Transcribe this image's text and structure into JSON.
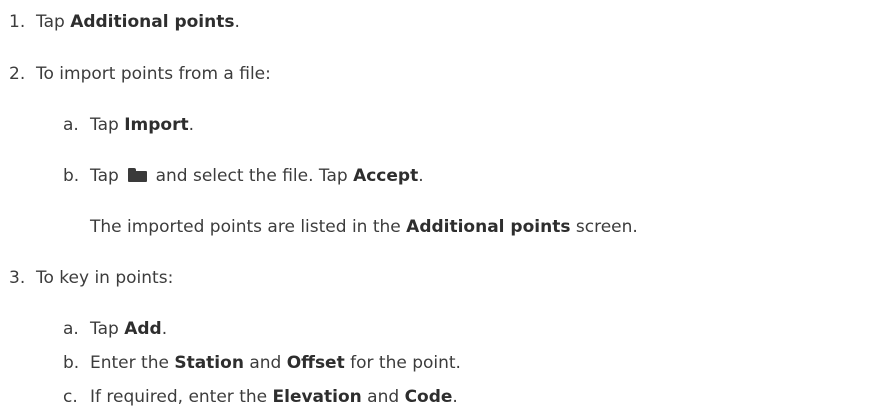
{
  "steps": [
    {
      "number": "1.",
      "parts": [
        "Tap ",
        "Additional points",
        "."
      ]
    },
    {
      "number": "2.",
      "text": "To import points from a file:",
      "substeps": [
        {
          "letter": "a.",
          "parts": [
            "Tap ",
            "Import",
            "."
          ]
        },
        {
          "letter": "b.",
          "parts": [
            "Tap ",
            " and select the file. Tap ",
            "Accept",
            "."
          ],
          "icon": "folder-icon",
          "note_parts": [
            "The imported points are listed in the ",
            "Additional points",
            " screen."
          ]
        }
      ]
    },
    {
      "number": "3.",
      "text": "To key in points:",
      "substeps": [
        {
          "letter": "a.",
          "parts": [
            "Tap ",
            "Add",
            "."
          ]
        },
        {
          "letter": "b.",
          "parts": [
            "Enter the ",
            "Station",
            " and ",
            "Offset",
            " for the point."
          ]
        },
        {
          "letter": "c.",
          "parts": [
            "If required, enter the ",
            "Elevation",
            " and ",
            "Code",
            "."
          ]
        }
      ]
    }
  ]
}
